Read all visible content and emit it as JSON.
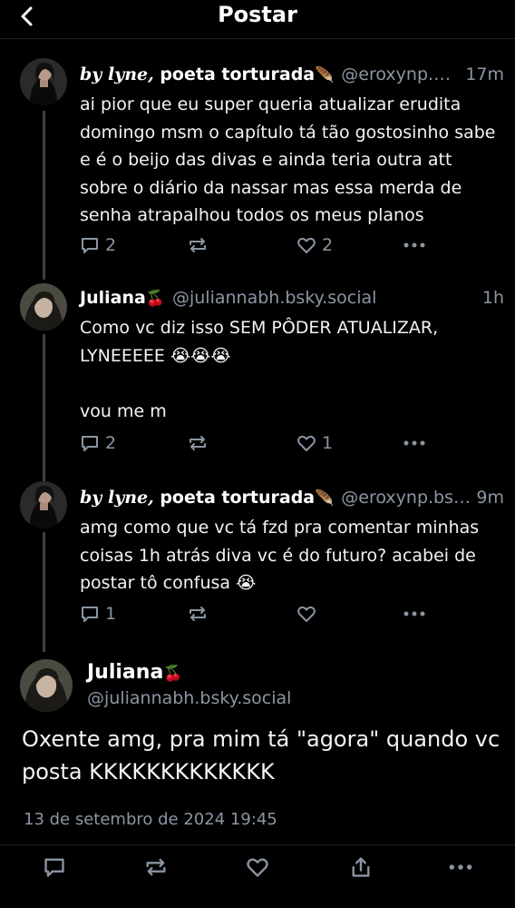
{
  "header": {
    "back_icon": "chevron-left-icon",
    "title": "Postar"
  },
  "thread": [
    {
      "name_italic": "by lyne,",
      "name_rest": " poeta torturada",
      "name_emoji": "🪶",
      "handle": "@eroxynp.bsky.social",
      "time": "17m",
      "text": "ai pior que eu super queria atualizar erudita domingo msm o capítulo tá tão gostosinho sabe e é o beijo das divas e ainda teria outra att sobre o diário da nassar mas essa merda de senha atrapalhou todos os meus planos",
      "replies": "2",
      "reposts": "",
      "likes": "2"
    },
    {
      "name": "Juliana",
      "name_emoji": "🍒",
      "handle": "@juliannabh.bsky.social",
      "time": "1h",
      "text": "Como vc diz isso SEM PÔDER ATUALIZAR, LYNEEEEE 😭😭😭\n\nvou me m",
      "replies": "2",
      "reposts": "",
      "likes": "1"
    },
    {
      "name_italic": "by lyne,",
      "name_rest": " poeta torturada",
      "name_emoji": "🪶",
      "handle": "@eroxynp.bsky.social",
      "time": "9m",
      "text": "amg como que vc tá fzd pra comentar minhas coisas 1h atrás diva vc é do futuro? acabei de postar tô confusa 😭",
      "replies": "1",
      "reposts": "",
      "likes": ""
    }
  ],
  "main_post": {
    "name": "Juliana",
    "name_emoji": "🍒",
    "handle": "@juliannabh.bsky.social",
    "text": "Oxente amg, pra mim tá \"agora\" quando vc posta KKKKKKKKKKKKK",
    "date": "13 de setembro de 2024 19:45"
  },
  "colors": {
    "background": "#000000",
    "text": "#f1f3f5",
    "muted": "#8b95a3",
    "thread_line": "#3a3f47"
  },
  "icons": [
    "chevron-left-icon",
    "reply-icon",
    "repost-icon",
    "like-icon",
    "more-icon",
    "share-icon"
  ]
}
